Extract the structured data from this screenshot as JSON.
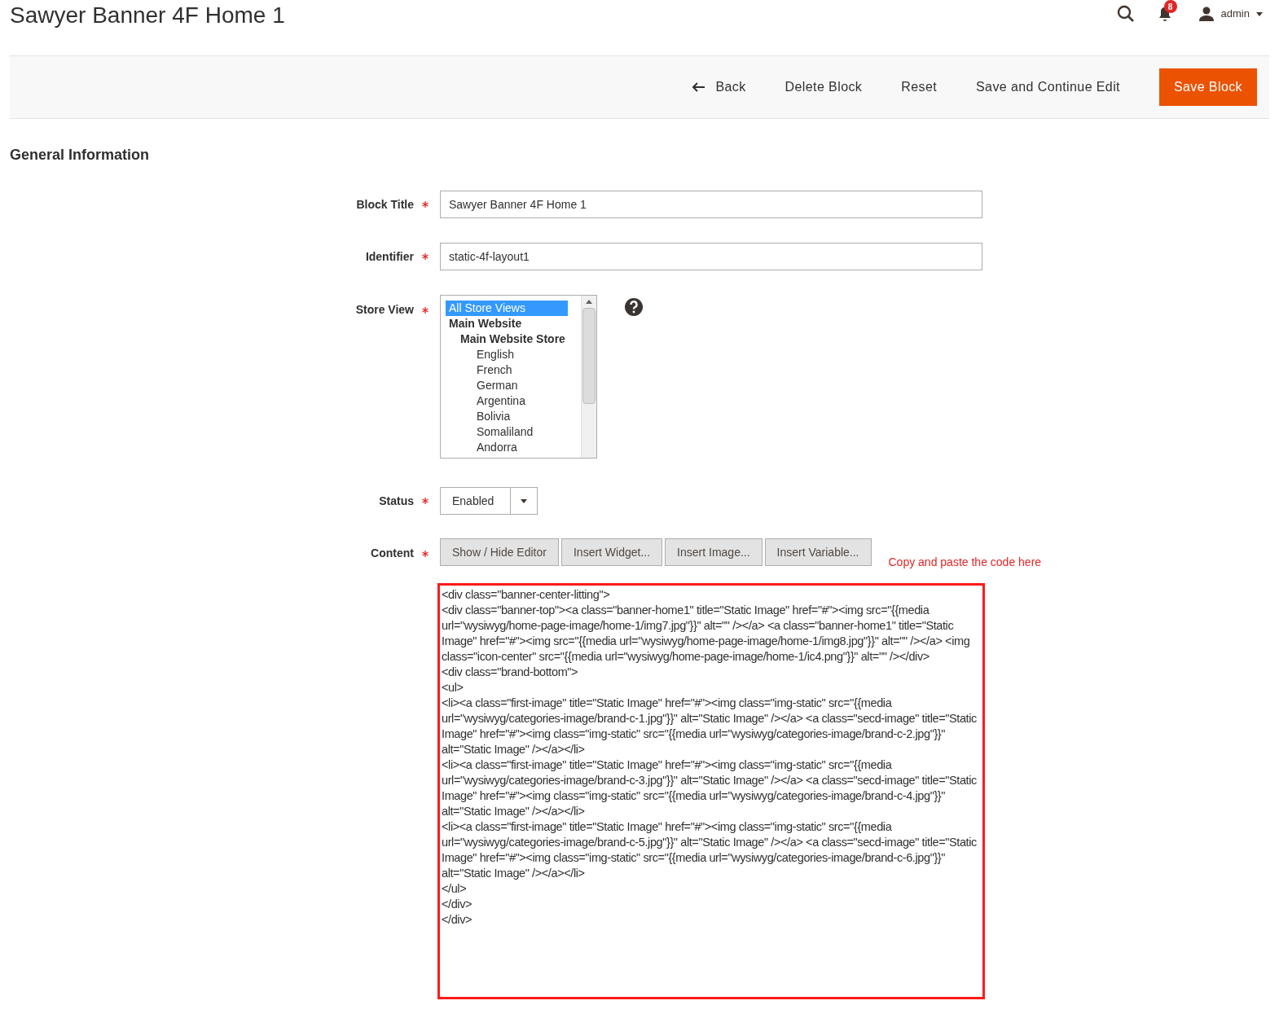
{
  "page_title": "Sawyer Banner 4F Home 1",
  "header": {
    "notifications_count": "8",
    "user": "admin"
  },
  "actions": [
    {
      "label": "Back",
      "kind": "back"
    },
    {
      "label": "Delete Block",
      "kind": "plain"
    },
    {
      "label": "Reset",
      "kind": "plain"
    },
    {
      "label": "Save and Continue Edit",
      "kind": "plain"
    },
    {
      "label": "Save Block",
      "kind": "primary"
    }
  ],
  "section_title": "General Information",
  "fields": {
    "block_title": {
      "label": "Block Title",
      "value": "Sawyer Banner 4F Home 1",
      "required": true
    },
    "identifier": {
      "label": "Identifier",
      "value": "static-4f-layout1",
      "required": true
    },
    "store_view": {
      "label": "Store View",
      "required": true,
      "options": [
        {
          "label": "All Store Views",
          "selected": true,
          "kind": "view"
        },
        {
          "label": "Main Website",
          "selected": false,
          "kind": "website",
          "children": [
            {
              "label": "Main Website Store",
              "selected": false,
              "kind": "store",
              "children": [
                {
                  "label": "English",
                  "selected": false,
                  "kind": "view"
                },
                {
                  "label": "French",
                  "selected": false,
                  "kind": "view"
                },
                {
                  "label": "German",
                  "selected": false,
                  "kind": "view"
                },
                {
                  "label": "Argentina",
                  "selected": false,
                  "kind": "view"
                },
                {
                  "label": "Bolivia",
                  "selected": false,
                  "kind": "view"
                },
                {
                  "label": "Somaliland",
                  "selected": false,
                  "kind": "view"
                },
                {
                  "label": "Andorra",
                  "selected": false,
                  "kind": "view"
                }
              ]
            }
          ]
        }
      ]
    },
    "status": {
      "label": "Status",
      "value": "Enabled",
      "required": true
    },
    "content": {
      "label": "Content",
      "required": true,
      "buttons": [
        "Show / Hide Editor",
        "Insert Widget...",
        "Insert Image...",
        "Insert Variable..."
      ],
      "annotation": "Copy and paste the code here",
      "code_lines": [
        "<div class=\"banner-center-litting\">",
        "<div class=\"banner-top\"><a class=\"banner-home1\" title=\"Static Image\" href=\"#\"><img src=\"{{media url=\"wysiwyg/home-page-image/home-1/img7.jpg\"}}\" alt=\"\" /></a> <a class=\"banner-home1\" title=\"Static Image\" href=\"#\"><img src=\"{{media url=\"wysiwyg/home-page-image/home-1/img8.jpg\"}}\" alt=\"\" /></a> <img class=\"icon-center\" src=\"{{media url=\"wysiwyg/home-page-image/home-1/ic4.png\"}}\" alt=\"\" /></div>",
        "<div class=\"brand-bottom\">",
        "<ul>",
        "<li><a class=\"first-image\" title=\"Static Image\" href=\"#\"><img class=\"img-static\" src=\"{{media url=\"wysiwyg/categories-image/brand-c-1.jpg\"}}\" alt=\"Static Image\" /></a> <a class=\"secd-image\" title=\"Static Image\" href=\"#\"><img class=\"img-static\" src=\"{{media url=\"wysiwyg/categories-image/brand-c-2.jpg\"}}\" alt=\"Static Image\" /></a></li>",
        "<li><a class=\"first-image\" title=\"Static Image\" href=\"#\"><img class=\"img-static\" src=\"{{media url=\"wysiwyg/categories-image/brand-c-3.jpg\"}}\" alt=\"Static Image\" /></a> <a class=\"secd-image\" title=\"Static Image\" href=\"#\"><img class=\"img-static\" src=\"{{media url=\"wysiwyg/categories-image/brand-c-4.jpg\"}}\" alt=\"Static Image\" /></a></li>",
        "<li><a class=\"first-image\" title=\"Static Image\" href=\"#\"><img class=\"img-static\" src=\"{{media url=\"wysiwyg/categories-image/brand-c-5.jpg\"}}\" alt=\"Static Image\" /></a> <a class=\"secd-image\" title=\"Static Image\" href=\"#\"><img class=\"img-static\" src=\"{{media url=\"wysiwyg/categories-image/brand-c-6.jpg\"}}\" alt=\"Static Image\" /></a></li>",
        "</ul>",
        "</div>",
        "</div>"
      ]
    }
  }
}
